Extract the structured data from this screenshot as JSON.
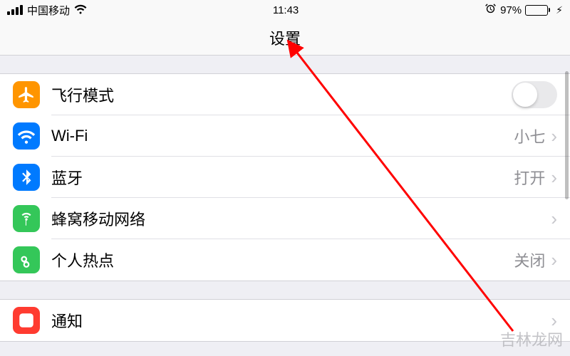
{
  "statusBar": {
    "carrier": "中国移动",
    "time": "11:43",
    "batteryPercent": "97%"
  },
  "nav": {
    "title": "设置"
  },
  "rows": {
    "airplane": {
      "label": "飞行模式"
    },
    "wifi": {
      "label": "Wi-Fi",
      "value": "小七"
    },
    "bluetooth": {
      "label": "蓝牙",
      "value": "打开"
    },
    "cellular": {
      "label": "蜂窝移动网络"
    },
    "hotspot": {
      "label": "个人热点",
      "value": "关闭"
    },
    "notifications": {
      "label": "通知"
    }
  },
  "watermark": "吉林龙网"
}
